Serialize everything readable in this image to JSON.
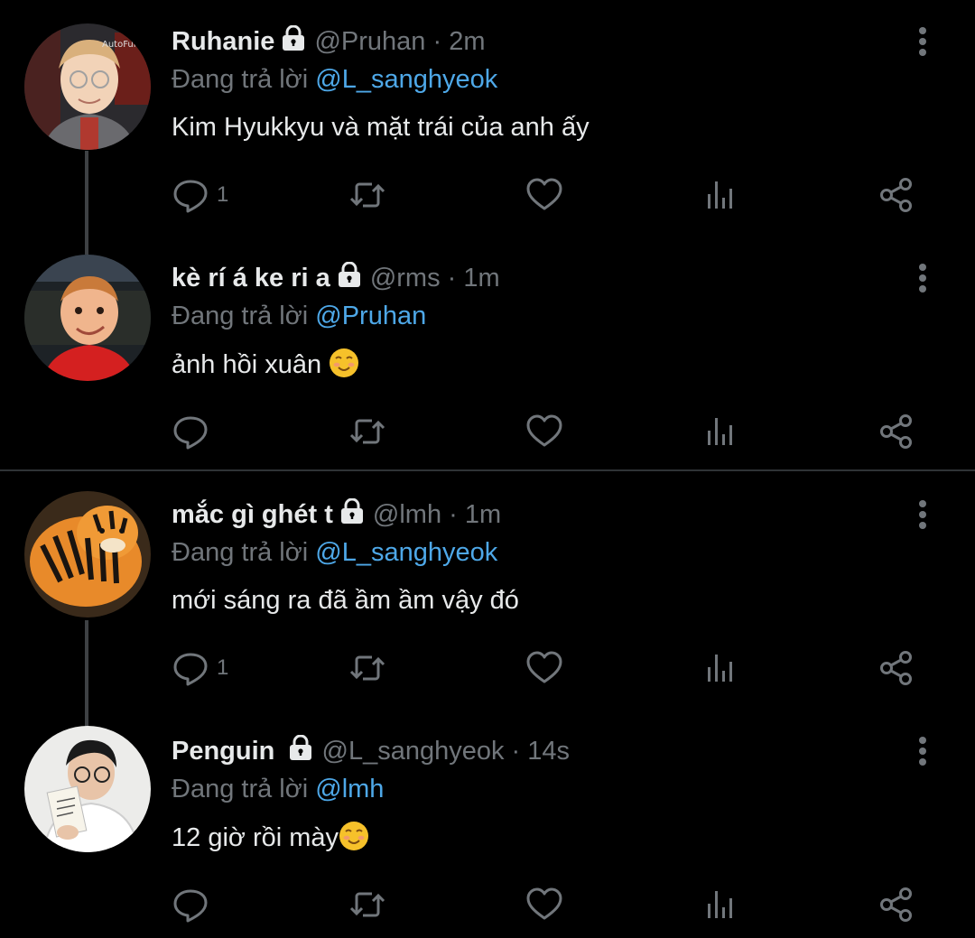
{
  "tweets": [
    {
      "display_name": "Ruhanie",
      "handle": "@Pruhan",
      "dot": "·",
      "time": "2m",
      "reply_prefix": "Đang trả lời",
      "reply_to": "@L_sanghyeok",
      "text": "Kim Hyukkyu và mặt trái của anh ấy",
      "reply_count": "1",
      "avatar_text": "AutoFull"
    },
    {
      "display_name": "kè rí á ke ri a",
      "handle": "@rms",
      "dot": "·",
      "time": "1m",
      "reply_prefix": "Đang trả lời",
      "reply_to": "@Pruhan",
      "text": "ảnh hồi xuân",
      "reply_count": ""
    },
    {
      "display_name": "mắc gì ghét t",
      "handle": "@lmh",
      "dot": "·",
      "time": "1m",
      "reply_prefix": "Đang trả lời",
      "reply_to": "@L_sanghyeok",
      "text": "mới sáng ra đã ầm ầm vậy đó",
      "reply_count": "1"
    },
    {
      "display_name": "Penguin",
      "handle": "@L_sanghyeok",
      "dot": "·",
      "time": "14s",
      "reply_prefix": "Đang trả lời",
      "reply_to": "@lmh",
      "text": "12 giờ rồi mày",
      "reply_count": ""
    }
  ],
  "icons": {
    "lock": "lock-icon",
    "more": "more-vertical-icon",
    "reply": "reply-icon",
    "retweet": "retweet-icon",
    "like": "heart-icon",
    "analytics": "analytics-icon",
    "share": "share-icon",
    "emoji": "smiling-face-emoji"
  },
  "colors": {
    "background": "#000000",
    "text": "#e7e9ea",
    "muted": "#71767b",
    "mention": "#4ea8e8",
    "thread_line": "#3e4144",
    "divider": "#2f3336"
  }
}
